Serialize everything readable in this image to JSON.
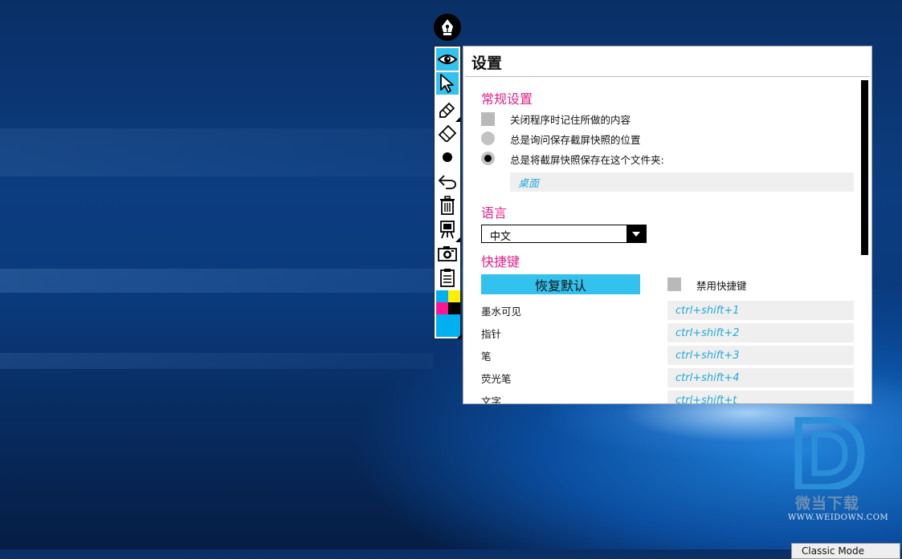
{
  "app": {
    "logo_icon": "fountain-pen-nib-icon"
  },
  "toolbar": {
    "tools": [
      {
        "id": "ink-visible",
        "icon": "eye-icon",
        "selected": true
      },
      {
        "id": "pointer",
        "icon": "cursor-arrow-icon",
        "selected": true
      },
      {
        "id": "pen",
        "icon": "pencil-icon",
        "selected": false
      },
      {
        "id": "highlighter",
        "icon": "highlighter-icon",
        "selected": false
      },
      {
        "id": "pen-size",
        "icon": "dot-icon",
        "selected": false
      },
      {
        "id": "undo",
        "icon": "undo-icon",
        "selected": false
      },
      {
        "id": "clear",
        "icon": "trash-icon",
        "selected": false
      },
      {
        "id": "board",
        "icon": "easel-board-icon",
        "selected": false
      },
      {
        "id": "screenshot",
        "icon": "camera-icon",
        "selected": false
      },
      {
        "id": "settings",
        "icon": "clipboard-icon",
        "selected": false
      }
    ],
    "palette": [
      "#00b0f0",
      "#ffee00",
      "#ff1493",
      "#000000",
      "#00b0f0"
    ]
  },
  "settings": {
    "title": "设置",
    "general": {
      "heading": "常规设置",
      "remember_label": "关闭程序时记住所做的内容",
      "ask_label": "总是询问保存截屏快照的位置",
      "save_to_label": "总是将截屏快照保存在这个文件夹:",
      "folder_value": "桌面"
    },
    "language": {
      "heading": "语言",
      "selected": "中文"
    },
    "shortcuts": {
      "heading": "快捷键",
      "restore_label": "恢复默认",
      "disable_label": "禁用快捷键",
      "items": [
        {
          "label": "墨水可见",
          "keys": "ctrl+shift+1"
        },
        {
          "label": "指针",
          "keys": "ctrl+shift+2"
        },
        {
          "label": "笔",
          "keys": "ctrl+shift+3"
        },
        {
          "label": "荧光笔",
          "keys": "ctrl+shift+4"
        },
        {
          "label": "文字",
          "keys": "ctrl+shift+t"
        }
      ]
    }
  },
  "watermark": {
    "brand": "微当下载",
    "url": "WWW.WEIDOWN.COM"
  },
  "tray": {
    "label": "Classic Mode"
  },
  "colors": {
    "accent_pink": "#e0208a",
    "accent_cyan": "#33c2ee"
  }
}
